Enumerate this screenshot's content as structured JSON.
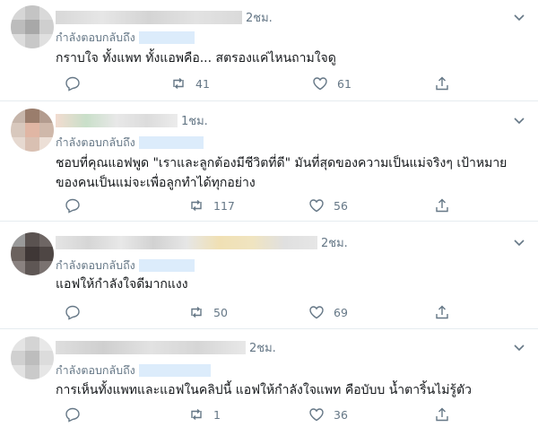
{
  "reply_label": "กำลังตอบกลับถึง",
  "colors": {
    "muted": "#657786",
    "divider": "#e6ecf0",
    "link_blur": "#dcecfb"
  },
  "tweets": [
    {
      "time": "2ชม.",
      "text": "กราบใจ ทั้งแพท ทั้งแอพคือ... สตรองแค่ไหนถามใจดู",
      "replies": "",
      "retweets": "41",
      "likes": "61"
    },
    {
      "time": "1ชม.",
      "text": "ชอบที่คุณแอฟพูด \"เราและลูกต้องมีชีวิตที่ดี\" มันที่สุดของความเป็นแม่จริงๆ เป้าหมายของคนเป็นแม่จะเพื่อลูกทำได้ทุกอย่าง",
      "replies": "",
      "retweets": "117",
      "likes": "56"
    },
    {
      "time": "2ชม.",
      "text": "แอฟให้กำลังใจดีมากแงง",
      "replies": "",
      "retweets": "50",
      "likes": "69"
    },
    {
      "time": "2ชม.",
      "text": "การเห็นทั้งแพทและแอฟในคลิปนี้ แอฟให้กำลังใจแพท คือบับบ น้ำตาริ้นไม่รู้ตัว",
      "replies": "",
      "retweets": "1",
      "likes": "36"
    }
  ]
}
